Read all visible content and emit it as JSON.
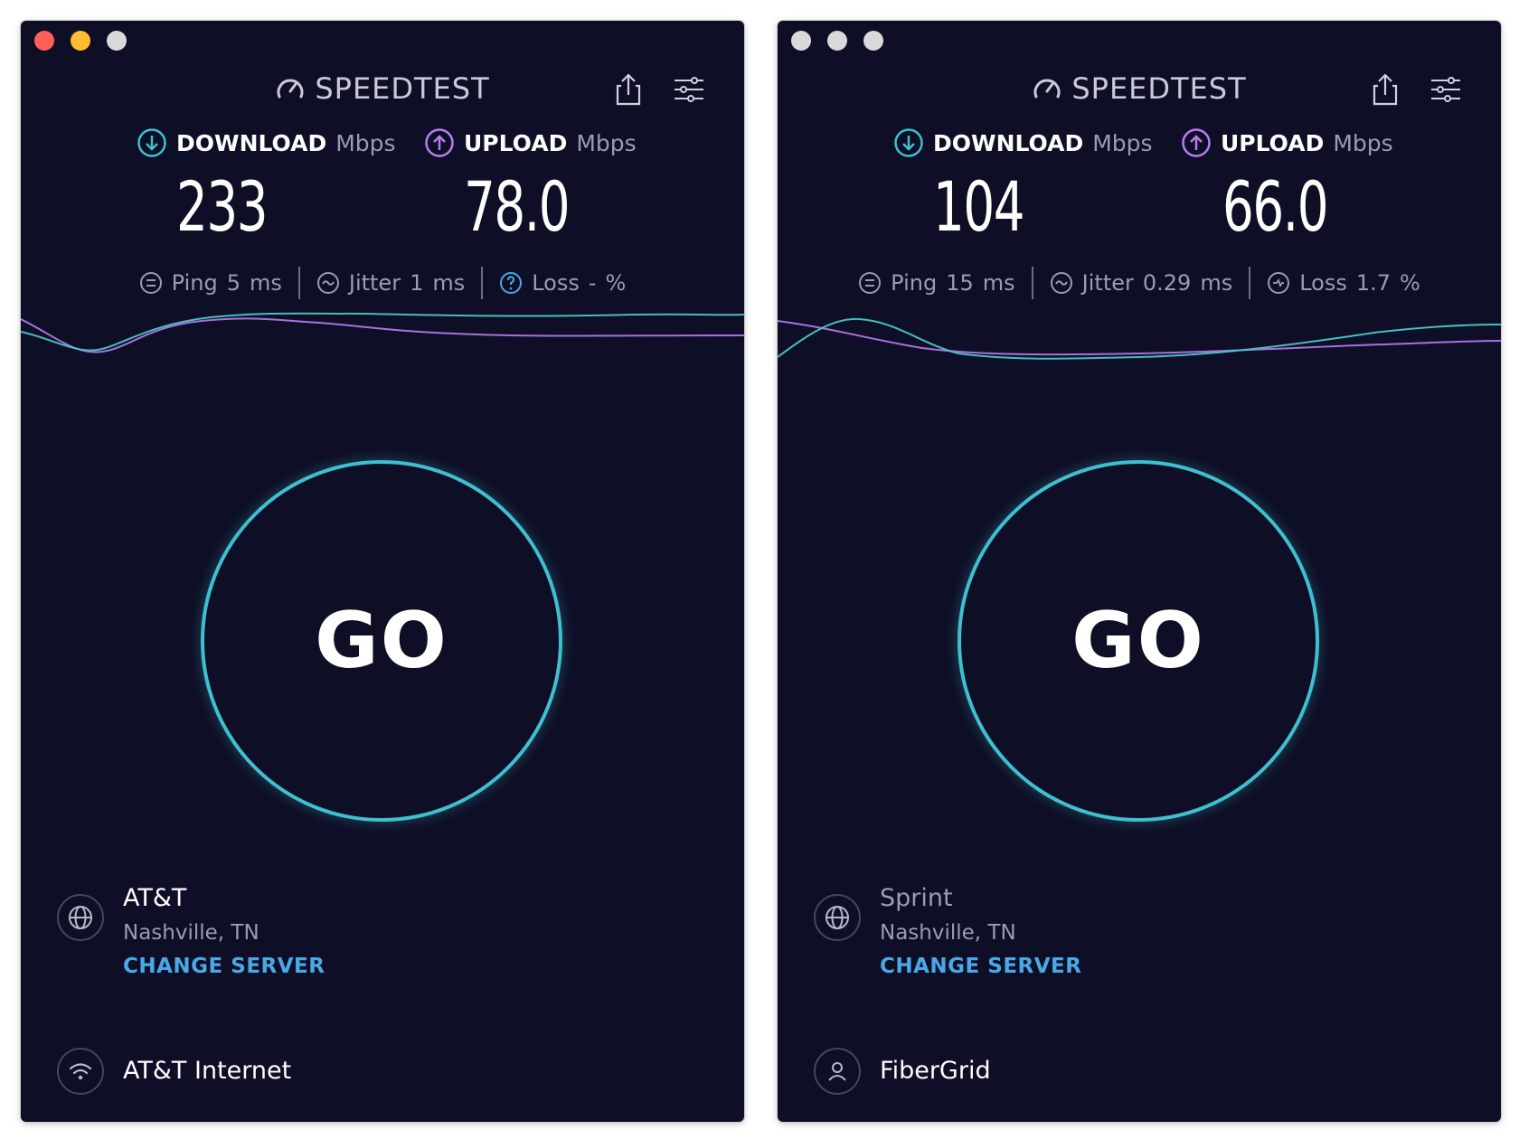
{
  "colors": {
    "background": "#0e0f26",
    "accent_teal": "#3fbfcf",
    "accent_purple": "#b97cf0",
    "link_blue": "#4aa8e6",
    "muted_text": "#9a9caf"
  },
  "windows": [
    {
      "traffic_lights": [
        "#ff5f57",
        "#febc2e",
        "#d9d9d9"
      ],
      "logo_text": "SPEEDTEST",
      "download": {
        "label": "DOWNLOAD",
        "unit": "Mbps",
        "value": "233"
      },
      "upload": {
        "label": "UPLOAD",
        "unit": "Mbps",
        "value": "78.0"
      },
      "ping": {
        "label": "Ping",
        "value": "5",
        "unit": "ms"
      },
      "jitter": {
        "label": "Jitter",
        "value": "1",
        "unit": "ms"
      },
      "loss": {
        "label": "Loss",
        "value": "-",
        "unit": "%"
      },
      "go_label": "GO",
      "server": {
        "name": "AT&T",
        "location": "Nashville, TN",
        "change_label": "CHANGE SERVER"
      },
      "connection": {
        "name": "AT&T Internet",
        "icon": "wifi-icon"
      }
    },
    {
      "traffic_lights": [
        "#d9d9d9",
        "#d9d9d9",
        "#d9d9d9"
      ],
      "logo_text": "SPEEDTEST",
      "download": {
        "label": "DOWNLOAD",
        "unit": "Mbps",
        "value": "104"
      },
      "upload": {
        "label": "UPLOAD",
        "unit": "Mbps",
        "value": "66.0"
      },
      "ping": {
        "label": "Ping",
        "value": "15",
        "unit": "ms"
      },
      "jitter": {
        "label": "Jitter",
        "value": "0.29",
        "unit": "ms"
      },
      "loss": {
        "label": "Loss",
        "value": "1.7",
        "unit": "%"
      },
      "go_label": "GO",
      "server": {
        "name": "Sprint",
        "location": "Nashville, TN",
        "change_label": "CHANGE SERVER"
      },
      "connection": {
        "name": "FiberGrid",
        "icon": "user-icon"
      }
    }
  ]
}
